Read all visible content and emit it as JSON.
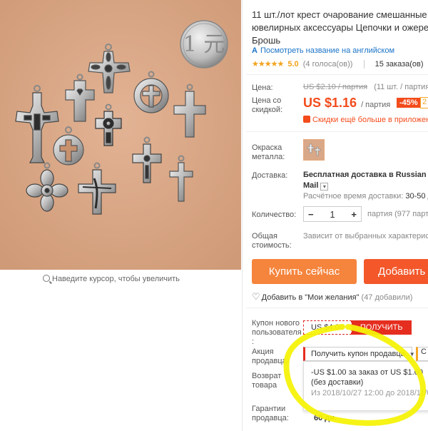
{
  "product": {
    "title_line1": "11 шт./лот крест очарование смешанные",
    "title_line2": "ювелирных аксессуары Цепочки и ожерел",
    "title_line3": "Брошь",
    "translate_link": "Посмотреть название на английском",
    "translate_icon_text": "A",
    "rating": {
      "stars": "★★★★★",
      "value": "5.0",
      "votes": "(4 голоса(ов))",
      "orders": "15 заказа(ов)"
    },
    "photo_coin_text": "1 元",
    "zoom_hint": "Наведите курсор, чтобы увеличить"
  },
  "price": {
    "label": "Цена:",
    "old": "US $2.10 / партия",
    "old_note": "(11 шт. / партия , U",
    "discount_label": "Цена со скидкой:",
    "new": "US $1.16",
    "new_unit": "/ партия",
    "discount_badge": "-45%",
    "coupon_mini": "2",
    "bigger_discount": "Скидки ещё больше в приложени"
  },
  "color": {
    "label": "Окраска металла:"
  },
  "delivery": {
    "label": "Доставка:",
    "value_line1": "Бесплатная доставка в Russian Fed",
    "value_line2": "Mail",
    "time_label": "Расчётное время доставки:",
    "time_value": "30-50 дн"
  },
  "quantity": {
    "label": "Количество:",
    "value": "1",
    "minus": "−",
    "plus": "+",
    "note": "партия (977 партия"
  },
  "total": {
    "label": "Общая стоимость:",
    "value": "Зависит от выбранных характеристи"
  },
  "buttons": {
    "buy_now": "Купить сейчас",
    "add_to_cart": "Добавить"
  },
  "wishlist": {
    "label": "Добавить в \"Мои желания\"",
    "count": "(47 добавили)"
  },
  "coupons": {
    "new_user_label": "Купон нового пользователя :",
    "new_user_amount": "US $4.00",
    "get_button": "ПОЛУЧИТЬ",
    "seller_promo_label": "Акция продавца:",
    "seller_coupon_button": "Получить купон продавца",
    "seller_coupon_button2": "С",
    "dropdown_line1": "-US $1.00 за заказ от US $1.00",
    "dropdown_line2": "(без доставки)",
    "dropdown_line3": "Из 2018/10/27 12:00 до 2018/11/09"
  },
  "returns": {
    "label": "Возврат товара"
  },
  "guarantee": {
    "label": "Гарантии продавца:",
    "value": "60 дн."
  },
  "colors": {
    "accent": "#f34b1b",
    "buy_button": "#f5843c",
    "cart_button": "#f3572a",
    "link": "#1a73c7",
    "star": "#f4a21a",
    "highlight_marker": "#f5f20a"
  }
}
